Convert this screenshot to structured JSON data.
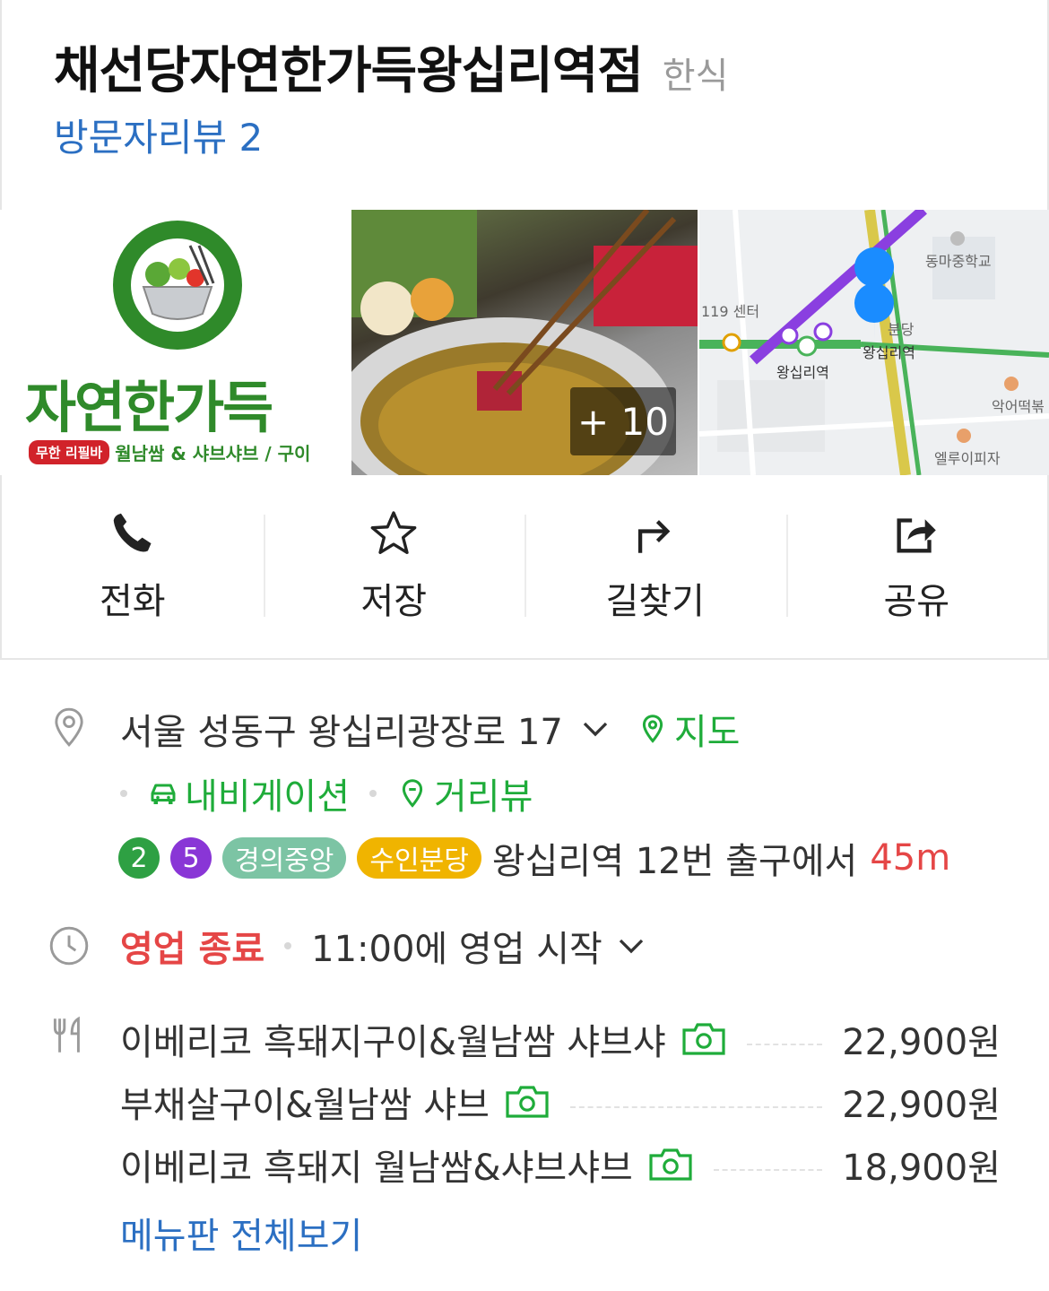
{
  "header": {
    "title": "채선당자연한가득왕십리역점",
    "category": "한식",
    "review_link": "방문자리뷰 2"
  },
  "photos": {
    "logo_text": "자연한가득",
    "logo_ring_text": "자연한가득",
    "logo_pill": "무한 리필바",
    "logo_sub": "월남쌈 & 샤브샤브 / 구이",
    "more_count": "+ 10",
    "map_labels": {
      "school": "동마중학교",
      "station": "왕십리역",
      "station2": "왕십리역",
      "center": "119 센터",
      "shop1": "악어떡볶",
      "shop2": "엘루이피자",
      "bundang": "분당"
    }
  },
  "actions": [
    {
      "label": "전화",
      "icon": "phone-icon"
    },
    {
      "label": "저장",
      "icon": "star-icon"
    },
    {
      "label": "길찾기",
      "icon": "directions-icon"
    },
    {
      "label": "공유",
      "icon": "share-icon"
    }
  ],
  "address": {
    "text": "서울 성동구 왕십리광장로 17",
    "map_link": "지도",
    "navigation_link": "내비게이션",
    "streetview_link": "거리뷰"
  },
  "subway": {
    "lines": [
      {
        "label": "2",
        "color": "#2ea043"
      },
      {
        "label": "5",
        "color": "#8936d6"
      },
      {
        "label": "경의중앙",
        "color": "#7cc4a4"
      },
      {
        "label": "수인분당",
        "color": "#f0b400"
      }
    ],
    "text": "왕십리역 12번 출구에서",
    "distance": "45m"
  },
  "hours": {
    "status": "영업 종료",
    "next": "11:00에 영업 시작"
  },
  "menu": {
    "items": [
      {
        "name": "이베리코 흑돼지구이&월남쌈 샤브샤",
        "price": "22,900원"
      },
      {
        "name": "부채살구이&월남쌈 샤브",
        "price": "22,900원"
      },
      {
        "name": "이베리코 흑돼지 월남쌈&샤브샤브",
        "price": "18,900원"
      }
    ],
    "view_all": "메뉴판 전체보기"
  },
  "colors": {
    "link_blue": "#2b6fc2",
    "green": "#1fac3a",
    "red": "#e54646"
  }
}
